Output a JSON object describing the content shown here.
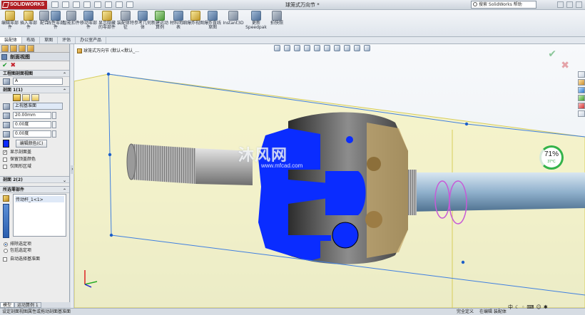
{
  "app": {
    "brand": "SOLIDWORKS",
    "doc_title": "球笼式万向节 *",
    "help_search_placeholder": "搜索 SolidWorks 帮助"
  },
  "ribbon": {
    "buttons": [
      {
        "label": "编辑零部件"
      },
      {
        "label": "插入零部件"
      },
      {
        "label": "配合"
      },
      {
        "label": "线性零部件"
      },
      {
        "label": "智能扣件"
      },
      {
        "label": "移动零部件"
      },
      {
        "label": "显示隐藏的零部件"
      },
      {
        "label": "装配体特征"
      },
      {
        "label": "参考几何体"
      },
      {
        "label": "新建运动算例"
      },
      {
        "label": "材料明细表"
      },
      {
        "label": "爆炸视图"
      },
      {
        "label": "爆炸直线草图"
      },
      {
        "label": "Instant3D"
      },
      {
        "label": "更新Speedpak"
      },
      {
        "label": "拍快照"
      }
    ]
  },
  "tabs": [
    {
      "label": "装配体",
      "active": true
    },
    {
      "label": "布局"
    },
    {
      "label": "草图"
    },
    {
      "label": "评估"
    },
    {
      "label": "办公室产品"
    }
  ],
  "property_manager": {
    "title": "剖面视图",
    "engineering_group": "工程图剖面视图",
    "engineering_value": "A",
    "section1_group": "剖面 1(1)",
    "section1_ref": "上视基准面",
    "offset": "20.00mm",
    "angle1": "0.00度",
    "angle2": "0.00度",
    "edit_color": "编辑颜色(C)",
    "options": [
      {
        "label": "显示剖面盖",
        "checked": true
      },
      {
        "label": "保留顶盖颜色",
        "checked": false
      },
      {
        "label": "仅图形区域",
        "checked": false
      }
    ],
    "section2_group": "剖面 2(2)",
    "selected_group": "所选零部件",
    "selected_items": [
      "传动杆_1<1>"
    ],
    "radios": [
      {
        "label": "排除选定项",
        "checked": true
      },
      {
        "label": "包括选定项",
        "checked": false
      }
    ],
    "auto_select": "自动选择基准面"
  },
  "bottom_tabs": [
    {
      "label": "模型",
      "active": true
    },
    {
      "label": "运动算例 1"
    }
  ],
  "status": {
    "message": "设定剖面视图属性或拖动剖面基准面",
    "state": "完全定义",
    "mode": "在编辑 装配体"
  },
  "viewport": {
    "tree_root": "球笼式万向节  (默认<默认_...",
    "watermark": "沐风网",
    "watermark_url": "www.mfcad.com",
    "gauge_percent": "71%",
    "gauge_temp": "37°C",
    "plane_color": "#f6f1a6",
    "section_color": "#0a2cff",
    "ime_label": "中"
  }
}
